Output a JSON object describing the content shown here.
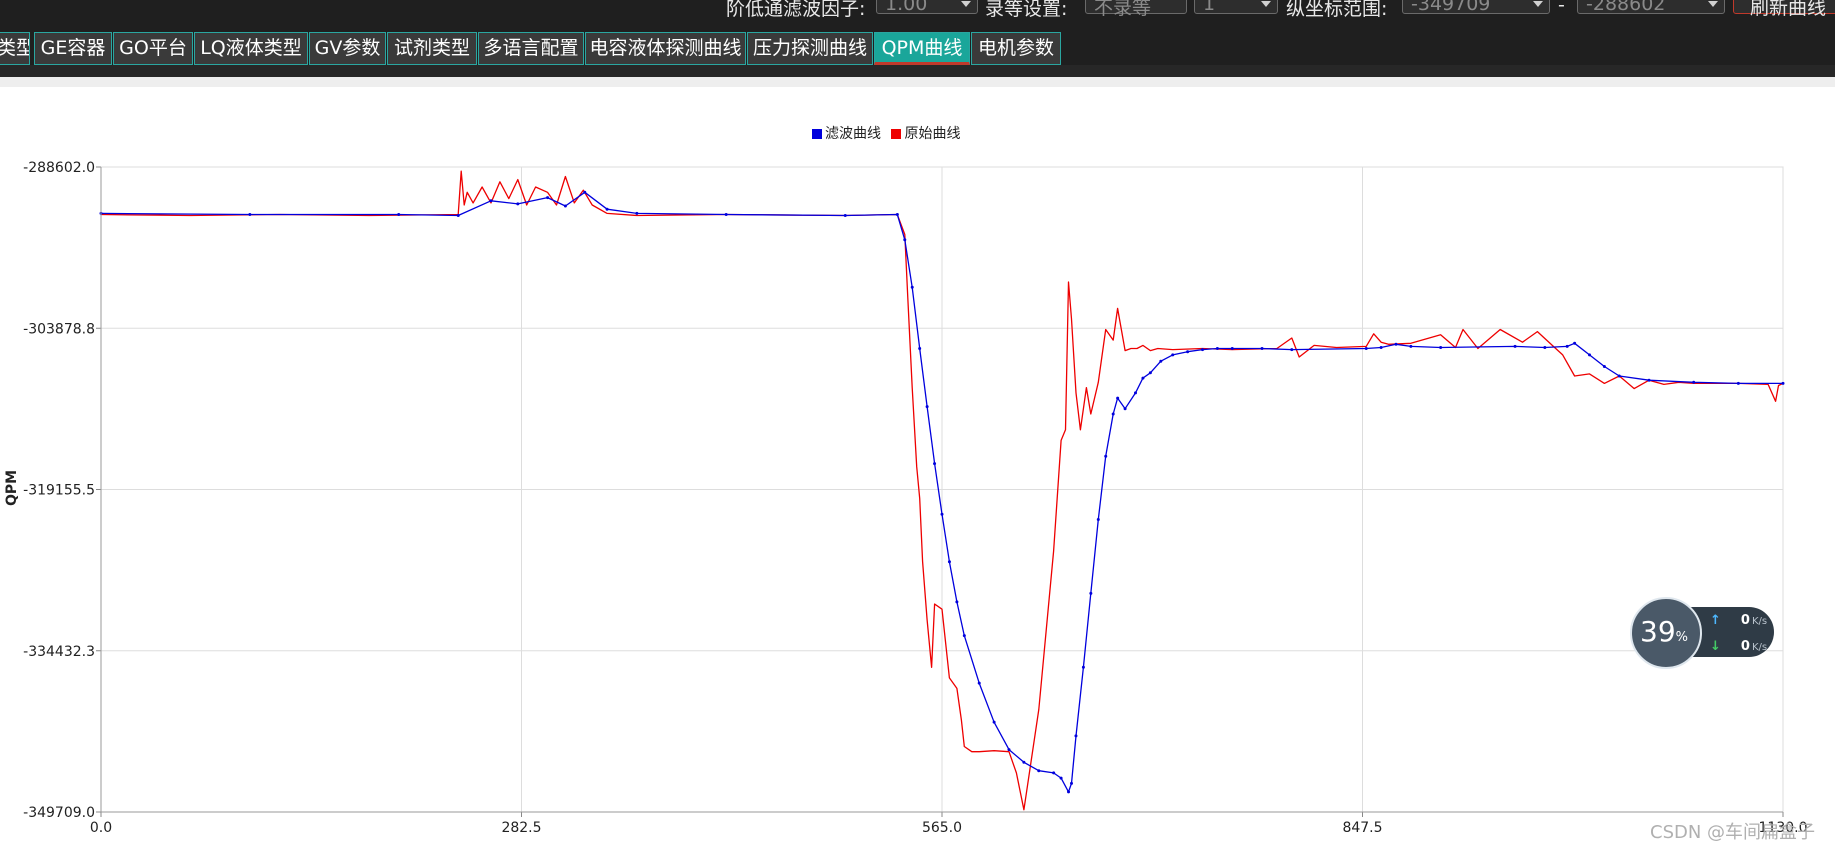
{
  "toolbar": {
    "filter_factor_label": "阶低通滤波因子:",
    "filter_factor_value": "1.00",
    "wait_label": "录等设置:",
    "wait_value": "不录等",
    "wait_number": "1",
    "y_range_label": "纵坐标范围:",
    "y_min_value": "-349709",
    "range_sep": "-",
    "y_max_value": "-288602",
    "refresh_button": "刷新曲线"
  },
  "tabs": [
    {
      "label": "类型",
      "active": false
    },
    {
      "label": "GE容器",
      "active": false
    },
    {
      "label": "GO平台",
      "active": false
    },
    {
      "label": "LQ液体类型",
      "active": false
    },
    {
      "label": "GV参数",
      "active": false
    },
    {
      "label": "试剂类型",
      "active": false
    },
    {
      "label": "多语言配置",
      "active": false
    },
    {
      "label": "电容液体探测曲线",
      "active": false
    },
    {
      "label": "压力探测曲线",
      "active": false
    },
    {
      "label": "QPM曲线",
      "active": true
    },
    {
      "label": "电机参数",
      "active": false
    }
  ],
  "chart_data": {
    "type": "line",
    "title": "",
    "xlabel": "",
    "ylabel": "QPM",
    "xlim": [
      0,
      1130
    ],
    "ylim": [
      -349709.0,
      -288602.0
    ],
    "x_ticks": [
      "0.0",
      "282.5",
      "565.0",
      "847.5",
      "1130.0"
    ],
    "y_ticks": [
      "-288602.0",
      "-303878.8",
      "-319155.5",
      "-334432.3",
      "-349709.0"
    ],
    "grid": true,
    "legend_position": "top-center",
    "series": [
      {
        "name": "滤波曲线",
        "color": "#0000dd",
        "x": [
          0,
          100,
          200,
          240,
          262,
          280,
          300,
          312,
          325,
          340,
          360,
          420,
          500,
          535,
          540,
          545,
          550,
          555,
          560,
          565,
          570,
          575,
          580,
          590,
          600,
          610,
          620,
          630,
          640,
          645,
          650,
          652,
          655,
          660,
          665,
          670,
          675,
          680,
          683,
          688,
          695,
          700,
          705,
          712,
          720,
          730,
          740,
          750,
          760,
          780,
          800,
          850,
          860,
          870,
          880,
          900,
          950,
          970,
          985,
          990,
          1000,
          1010,
          1020,
          1040,
          1070,
          1100,
          1130
        ],
        "y": [
          -293000,
          -293100,
          -293100,
          -293200,
          -291800,
          -292100,
          -291500,
          -292300,
          -291000,
          -292600,
          -293000,
          -293100,
          -293200,
          -293100,
          -295500,
          -300000,
          -305800,
          -311300,
          -316700,
          -321500,
          -326000,
          -329800,
          -333000,
          -337500,
          -341200,
          -343800,
          -345000,
          -345800,
          -346000,
          -346500,
          -347800,
          -347000,
          -342500,
          -336000,
          -329000,
          -322000,
          -316000,
          -312000,
          -310500,
          -311500,
          -310000,
          -308600,
          -308100,
          -307000,
          -306400,
          -306100,
          -305900,
          -305800,
          -305800,
          -305800,
          -305900,
          -305800,
          -305700,
          -305400,
          -305600,
          -305700,
          -305600,
          -305700,
          -305600,
          -305300,
          -306400,
          -307500,
          -308400,
          -308800,
          -309000,
          -309100,
          -309100
        ]
      },
      {
        "name": "原始曲线",
        "color": "#ee0000",
        "x": [
          0,
          60,
          120,
          180,
          240,
          242,
          244,
          246,
          250,
          256,
          262,
          268,
          274,
          280,
          286,
          292,
          300,
          306,
          312,
          318,
          324,
          330,
          340,
          360,
          420,
          500,
          535,
          540,
          542,
          545,
          548,
          550,
          552,
          555,
          558,
          560,
          565,
          570,
          575,
          578,
          580,
          585,
          590,
          600,
          610,
          615,
          620,
          630,
          640,
          645,
          648,
          650,
          652,
          655,
          658,
          662,
          665,
          670,
          675,
          680,
          683,
          688,
          692,
          696,
          700,
          705,
          710,
          720,
          740,
          760,
          790,
          800,
          805,
          815,
          830,
          850,
          855,
          860,
          865,
          880,
          900,
          910,
          915,
          925,
          940,
          955,
          965,
          975,
          982,
          990,
          1000,
          1010,
          1020,
          1030,
          1040,
          1050,
          1060,
          1070,
          1080,
          1100,
          1120,
          1125,
          1127,
          1130
        ],
        "y": [
          -293100,
          -293200,
          -293100,
          -293200,
          -293100,
          -289000,
          -292200,
          -291000,
          -292000,
          -290500,
          -292000,
          -290000,
          -291600,
          -289800,
          -292200,
          -290500,
          -291000,
          -292200,
          -289500,
          -292000,
          -290800,
          -292200,
          -293000,
          -293200,
          -293100,
          -293200,
          -293100,
          -295000,
          -301000,
          -309500,
          -317000,
          -320000,
          -326000,
          -331500,
          -336000,
          -330000,
          -330500,
          -337000,
          -338000,
          -341000,
          -343500,
          -344000,
          -344000,
          -343900,
          -344000,
          -346000,
          -349500,
          -340000,
          -325000,
          -314500,
          -313500,
          -299500,
          -303000,
          -310000,
          -313500,
          -309500,
          -312000,
          -309000,
          -304000,
          -305000,
          -302000,
          -306000,
          -305800,
          -305800,
          -305500,
          -306000,
          -305800,
          -305900,
          -305800,
          -305900,
          -305800,
          -304800,
          -306600,
          -305500,
          -305700,
          -305600,
          -304400,
          -305200,
          -305400,
          -305300,
          -304500,
          -305700,
          -304000,
          -305800,
          -304000,
          -305200,
          -304200,
          -305500,
          -306400,
          -308400,
          -308200,
          -309100,
          -308400,
          -309600,
          -308800,
          -309200,
          -309000,
          -309100,
          -309100,
          -309100,
          -309200,
          -310800,
          -309300,
          -309100
        ]
      }
    ]
  },
  "widget": {
    "percent": "39",
    "percent_unit": "%",
    "upload": "0",
    "download": "0",
    "speed_unit": "K/s"
  },
  "watermark": "CSDN @车间扁盒子"
}
